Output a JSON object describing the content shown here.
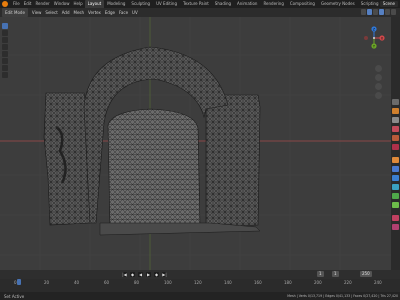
{
  "topbar": {
    "menus": [
      "File",
      "Edit",
      "Render",
      "Window",
      "Help"
    ],
    "workspaces": [
      "Layout",
      "Modeling",
      "Sculpting",
      "UV Editing",
      "Texture Paint",
      "Shading",
      "Animation",
      "Rendering",
      "Compositing",
      "Geometry Nodes",
      "Scripting"
    ],
    "active_workspace": "Layout",
    "scene": "Scene"
  },
  "header": {
    "mode": "Edit Mode",
    "items": [
      "View",
      "Select",
      "Add",
      "Mesh",
      "Vertex",
      "Edge",
      "Face",
      "UV"
    ]
  },
  "viewport": {
    "axis_x_color": "#a34a4a",
    "axis_y_color": "#6a8f2f",
    "gizmo": {
      "x": "X",
      "y": "Y",
      "z": "Z"
    }
  },
  "timeline": {
    "current_frame": "1",
    "start": "1",
    "end": "250",
    "ticks": [
      "0",
      "10",
      "20",
      "30",
      "40",
      "50",
      "60",
      "70",
      "80",
      "90",
      "100",
      "110",
      "120",
      "130",
      "140",
      "150",
      "160",
      "170",
      "180",
      "190",
      "200",
      "210",
      "220",
      "230",
      "240",
      "250"
    ]
  },
  "statusbar": {
    "left": "Set Active",
    "right": "Mesh | Verts 0/13,719 | Edges 0/41,133 | Faces 0/27,420 | Tris 27,420"
  }
}
